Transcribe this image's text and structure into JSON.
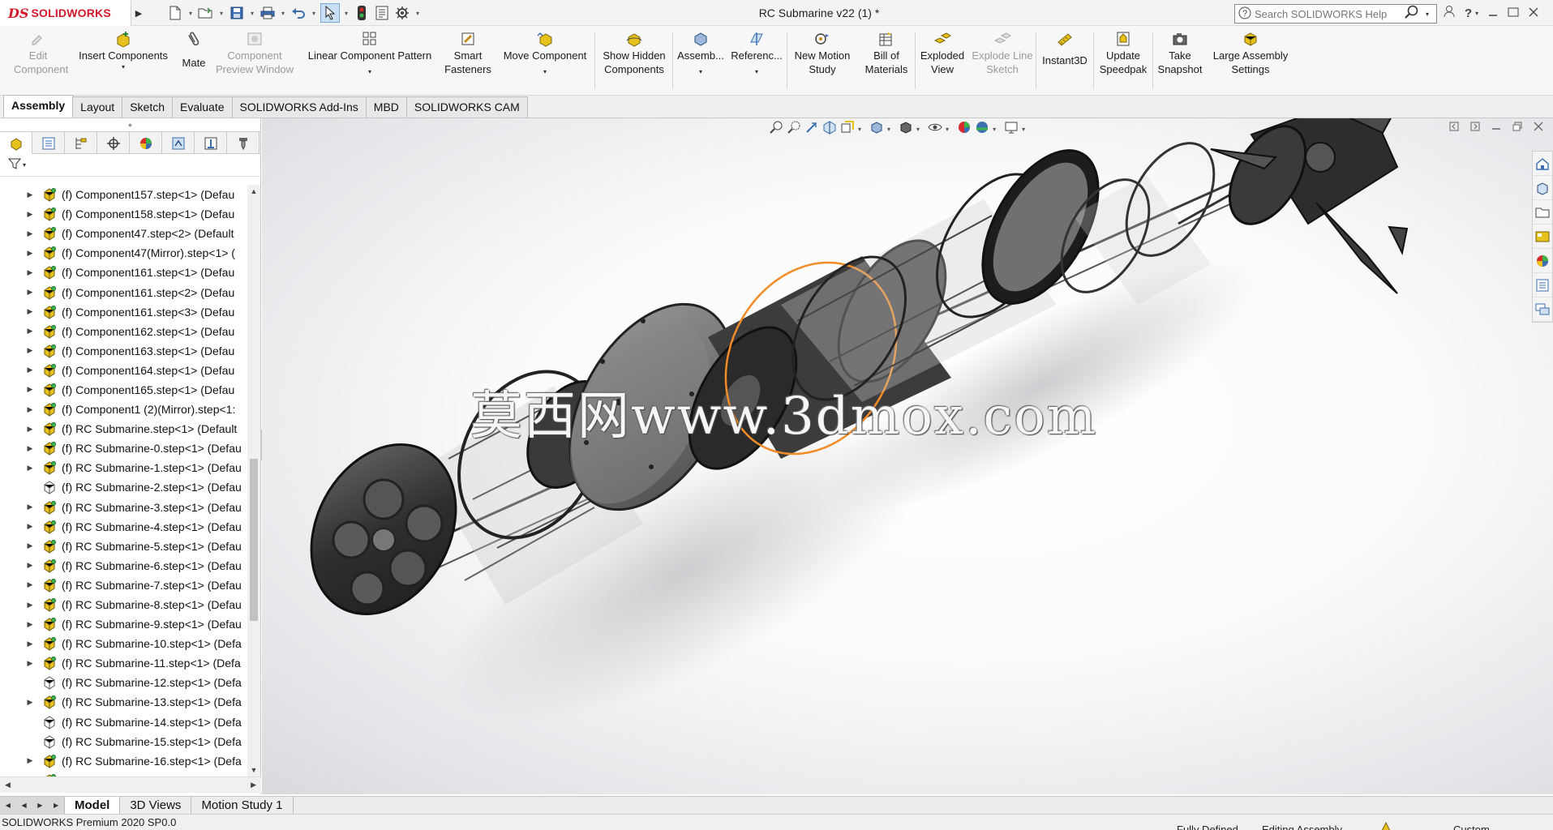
{
  "app": {
    "logo_mark": "DS",
    "logo_text": "SOLIDWORKS",
    "document_title": "RC Submarine v22 (1) *",
    "search_placeholder": "Search SOLIDWORKS Help"
  },
  "quick_access": [
    "new-doc-icon",
    "open-icon",
    "save-icon",
    "print-icon",
    "undo-icon",
    "select-icon",
    "rebuild-icon",
    "file-properties-icon",
    "options-icon"
  ],
  "ribbon": {
    "edit_component": "Edit Component",
    "insert_components": "Insert Components",
    "mate": "Mate",
    "component_preview": "Component Preview Window",
    "linear_pattern": "Linear Component Pattern",
    "smart_fasteners": "Smart Fasteners",
    "move_component": "Move Component",
    "show_hidden": "Show Hidden Components",
    "assembly": "Assemb...",
    "reference": "Referenc...",
    "motion_study": "New Motion Study",
    "bill_of_materials": "Bill of Materials",
    "exploded_view": "Exploded View",
    "explode_line": "Explode Line Sketch",
    "instant3d": "Instant3D",
    "update_speedpak": "Update Speedpak",
    "take_snapshot": "Take Snapshot",
    "large_assembly": "Large Assembly Settings"
  },
  "command_tabs": [
    "Assembly",
    "Layout",
    "Sketch",
    "Evaluate",
    "SOLIDWORKS Add-Ins",
    "MBD",
    "SOLIDWORKS CAM"
  ],
  "active_command_tab": "Assembly",
  "feature_tree": [
    {
      "label": "(f) Component157.step<1> (Defau",
      "expandable": true,
      "icon": "part-fixed"
    },
    {
      "label": "(f) Component158.step<1> (Defau",
      "expandable": true,
      "icon": "part-fixed"
    },
    {
      "label": "(f) Component47.step<2> (Default",
      "expandable": true,
      "icon": "part-fixed"
    },
    {
      "label": "(f) Component47(Mirror).step<1> (",
      "expandable": true,
      "icon": "part-fixed"
    },
    {
      "label": "(f) Component161.step<1> (Defau",
      "expandable": true,
      "icon": "part-fixed"
    },
    {
      "label": "(f) Component161.step<2> (Defau",
      "expandable": true,
      "icon": "part-fixed"
    },
    {
      "label": "(f) Component161.step<3> (Defau",
      "expandable": true,
      "icon": "part-fixed"
    },
    {
      "label": "(f) Component162.step<1> (Defau",
      "expandable": true,
      "icon": "part-fixed"
    },
    {
      "label": "(f) Component163.step<1> (Defau",
      "expandable": true,
      "icon": "part-fixed"
    },
    {
      "label": "(f) Component164.step<1> (Defau",
      "expandable": true,
      "icon": "part-fixed"
    },
    {
      "label": "(f) Component165.step<1> (Defau",
      "expandable": true,
      "icon": "part-fixed"
    },
    {
      "label": "(f) Component1 (2)(Mirror).step<1:",
      "expandable": true,
      "icon": "part-fixed"
    },
    {
      "label": "(f) RC Submarine.step<1> (Default",
      "expandable": true,
      "icon": "part-fixed"
    },
    {
      "label": "(f) RC Submarine-0.step<1> (Defau",
      "expandable": true,
      "icon": "part-fixed"
    },
    {
      "label": "(f) RC Submarine-1.step<1> (Defau",
      "expandable": true,
      "icon": "part-fixed"
    },
    {
      "label": "(f) RC Submarine-2.step<1> (Defau",
      "expandable": false,
      "icon": "part-outline"
    },
    {
      "label": "(f) RC Submarine-3.step<1> (Defau",
      "expandable": true,
      "icon": "part-fixed"
    },
    {
      "label": "(f) RC Submarine-4.step<1> (Defau",
      "expandable": true,
      "icon": "part-fixed"
    },
    {
      "label": "(f) RC Submarine-5.step<1> (Defau",
      "expandable": true,
      "icon": "part-fixed"
    },
    {
      "label": "(f) RC Submarine-6.step<1> (Defau",
      "expandable": true,
      "icon": "part-fixed"
    },
    {
      "label": "(f) RC Submarine-7.step<1> (Defau",
      "expandable": true,
      "icon": "part-fixed"
    },
    {
      "label": "(f) RC Submarine-8.step<1> (Defau",
      "expandable": true,
      "icon": "part-fixed"
    },
    {
      "label": "(f) RC Submarine-9.step<1> (Defau",
      "expandable": true,
      "icon": "part-fixed"
    },
    {
      "label": "(f) RC Submarine-10.step<1> (Defa",
      "expandable": true,
      "icon": "part-fixed"
    },
    {
      "label": "(f) RC Submarine-11.step<1> (Defa",
      "expandable": true,
      "icon": "part-fixed"
    },
    {
      "label": "(f) RC Submarine-12.step<1> (Defa",
      "expandable": false,
      "icon": "part-outline"
    },
    {
      "label": "(f) RC Submarine-13.step<1> (Defa",
      "expandable": true,
      "icon": "part-fixed"
    },
    {
      "label": "(f) RC Submarine-14.step<1> (Defa",
      "expandable": false,
      "icon": "part-outline"
    },
    {
      "label": "(f) RC Submarine-15.step<1> (Defa",
      "expandable": false,
      "icon": "part-outline"
    },
    {
      "label": "(f) RC Submarine-16.step<1> (Defa",
      "expandable": true,
      "icon": "part-fixed"
    },
    {
      "label": "",
      "expandable": true,
      "icon": "part-fixed"
    }
  ],
  "watermark": "莫西网www.3dmox.com",
  "bottom_tabs": [
    "Model",
    "3D Views",
    "Motion Study 1"
  ],
  "active_bottom_tab": "Model",
  "status": {
    "product": "SOLIDWORKS Premium 2020 SP0.0",
    "state": "Fully Defined",
    "mode": "Editing Assembly",
    "units": "Custom"
  },
  "colors": {
    "brand_red": "#d2182b",
    "selection_orange": "#f28c28",
    "part_fixed_yellow": "#e8c21c"
  }
}
